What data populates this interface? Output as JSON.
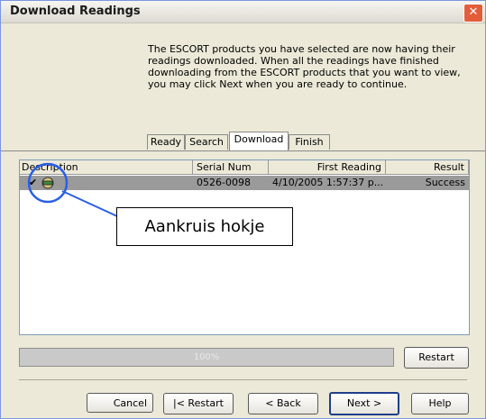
{
  "window": {
    "title": "Download Readings"
  },
  "intro_text": "The ESCORT products you have selected are now having their readings downloaded. When all the readings have finished downloading from the ESCORT products that you want to view, you may click Next when you are ready to continue.",
  "tabs": [
    {
      "label": "Ready",
      "active": false
    },
    {
      "label": "Search",
      "active": false
    },
    {
      "label": "Download",
      "active": true
    },
    {
      "label": "Finish",
      "active": false
    }
  ],
  "table": {
    "columns": [
      "Description",
      "Serial Num",
      "First Reading",
      "Result"
    ],
    "rows": [
      {
        "description": "",
        "serial": "0526-0098",
        "first_reading": "4/10/2005 1:57:37 p...",
        "result": "Success",
        "checked": true
      }
    ]
  },
  "annotation": {
    "label": "Aankruis hokje",
    "color": "#2a5ee8"
  },
  "progress": {
    "value": 100,
    "label": "100%"
  },
  "buttons": {
    "restart": "Restart",
    "cancel": "Cancel",
    "restart_first": "|< Restart",
    "back": "< Back",
    "next": "Next >",
    "help": "Help"
  },
  "icons": {
    "check": "check-icon",
    "device": "device-icon",
    "close": "close-icon"
  }
}
